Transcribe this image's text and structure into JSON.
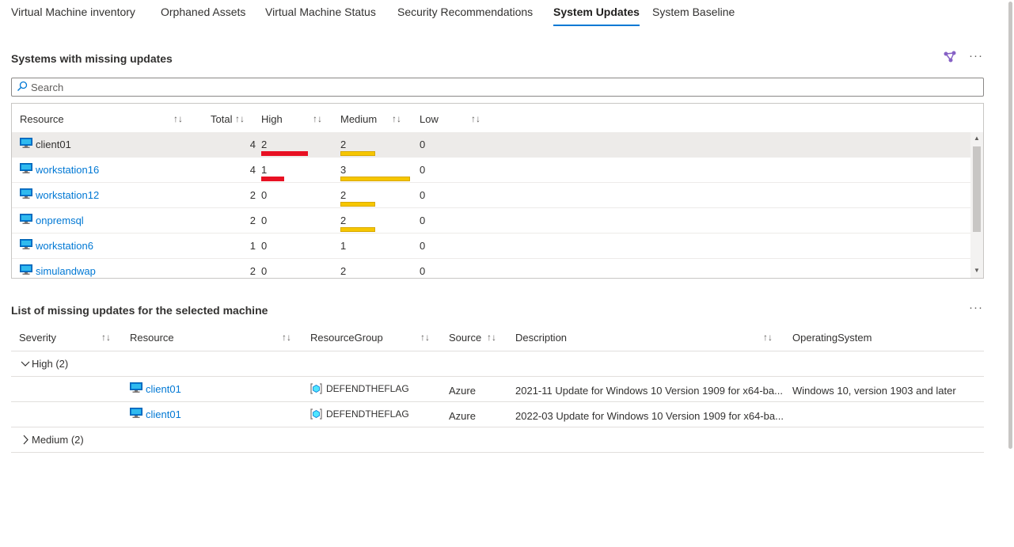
{
  "tabs": [
    {
      "label": "Virtual Machine inventory"
    },
    {
      "label": "Orphaned Assets"
    },
    {
      "label": "Virtual Machine Status"
    },
    {
      "label": "Security Recommendations"
    },
    {
      "label": "System Updates"
    },
    {
      "label": "System Baseline"
    }
  ],
  "active_tab": "System Updates",
  "top_section": {
    "title": "Systems with missing updates",
    "more": "···",
    "search_placeholder": "Search",
    "columns": {
      "resource": "Resource",
      "total": "Total",
      "high": "High",
      "medium": "Medium",
      "low": "Low"
    },
    "sort_glyph": "↑↓",
    "rows": [
      {
        "resource": "client01",
        "total": "4",
        "high": "2",
        "medium": "2",
        "low": "0",
        "high_fraction": 0.667,
        "medium_fraction": 0.5,
        "selected": true
      },
      {
        "resource": "workstation16",
        "total": "4",
        "high": "1",
        "medium": "3",
        "low": "0",
        "high_fraction": 0.333,
        "medium_fraction": 1.0
      },
      {
        "resource": "workstation12",
        "total": "2",
        "high": "0",
        "medium": "2",
        "low": "0",
        "high_fraction": 0,
        "medium_fraction": 0.5
      },
      {
        "resource": "onpremsql",
        "total": "2",
        "high": "0",
        "medium": "2",
        "low": "0",
        "high_fraction": 0,
        "medium_fraction": 0.5
      },
      {
        "resource": "workstation6",
        "total": "1",
        "high": "0",
        "medium": "1",
        "low": "0",
        "high_fraction": 0,
        "medium_fraction": 0
      },
      {
        "resource": "simulandwap",
        "total": "2",
        "high": "0",
        "medium": "2",
        "low": "0",
        "high_fraction": 0,
        "medium_fraction": 0.5
      }
    ]
  },
  "bottom_section": {
    "title": "List of missing updates for the selected machine",
    "more": "···",
    "columns": {
      "severity": "Severity",
      "resource": "Resource",
      "resource_group": "ResourceGroup",
      "source": "Source",
      "description": "Description",
      "os": "OperatingSystem"
    },
    "groups": [
      {
        "label": "High (2)",
        "expanded": true
      },
      {
        "label": "Medium (2)",
        "expanded": false
      }
    ],
    "rows": [
      {
        "resource": "client01",
        "resource_group": "DEFENDTHEFLAG",
        "source": "Azure",
        "description": "2021-11 Update for Windows 10 Version 1909 for x64-ba...",
        "os": "Windows 10, version 1903 and later"
      },
      {
        "resource": "client01",
        "resource_group": "DEFENDTHEFLAG",
        "source": "Azure",
        "description": "2022-03 Update for Windows 10 Version 1909 for x64-ba...",
        "os": ""
      }
    ]
  },
  "colors": {
    "accent": "#0078d4",
    "high": "#e81123",
    "medium": "#f6c600"
  }
}
